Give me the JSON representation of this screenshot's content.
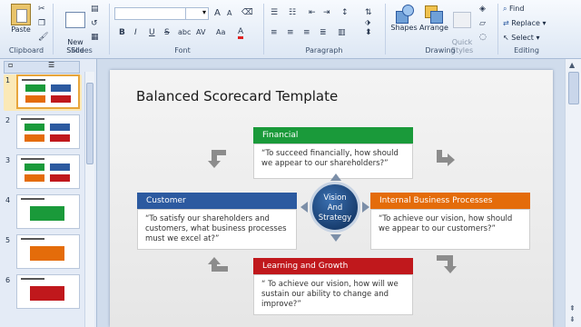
{
  "ribbon": {
    "clipboard": {
      "paste_label": "Paste",
      "group_label": "Clipboard"
    },
    "slides": {
      "new_slide_label": "New\nSlide",
      "group_label": "Slides"
    },
    "font": {
      "group_label": "Font",
      "bold": "B",
      "italic": "I",
      "underline": "U",
      "strike": "S",
      "shadow": "abc",
      "spacing": "AV",
      "case": "Aa",
      "grow": "A",
      "shrink": "A"
    },
    "paragraph": {
      "group_label": "Paragraph"
    },
    "drawing": {
      "shapes_label": "Shapes",
      "arrange_label": "Arrange",
      "quick_styles_label": "Quick\nStyles",
      "group_label": "Drawing"
    },
    "editing": {
      "find_label": "Find",
      "replace_label": "Replace",
      "select_label": "Select",
      "group_label": "Editing"
    }
  },
  "thumbnails": [
    "1",
    "2",
    "3",
    "4",
    "5",
    "6"
  ],
  "slide": {
    "title": "Balanced Scorecard Template",
    "center": {
      "line1": "Vision",
      "line2": "And",
      "line3": "Strategy"
    },
    "financial": {
      "header": "Financial",
      "text": "“To succeed financially, how should we appear to our shareholders?”",
      "color": "#1a9a3a"
    },
    "customer": {
      "header": "Customer",
      "text": "“To satisfy our shareholders and customers, what business processes must we excel at?”",
      "color": "#2c5aa0"
    },
    "internal": {
      "header": "Internal Business Processes",
      "text": "“To achieve our vision, how should we appear to our customers?”",
      "color": "#e46c0a"
    },
    "learning": {
      "header": "Learning and Growth",
      "text": "“ To achieve our vision, how will we sustain our ability to change and improve?”",
      "color": "#c0181c"
    }
  }
}
